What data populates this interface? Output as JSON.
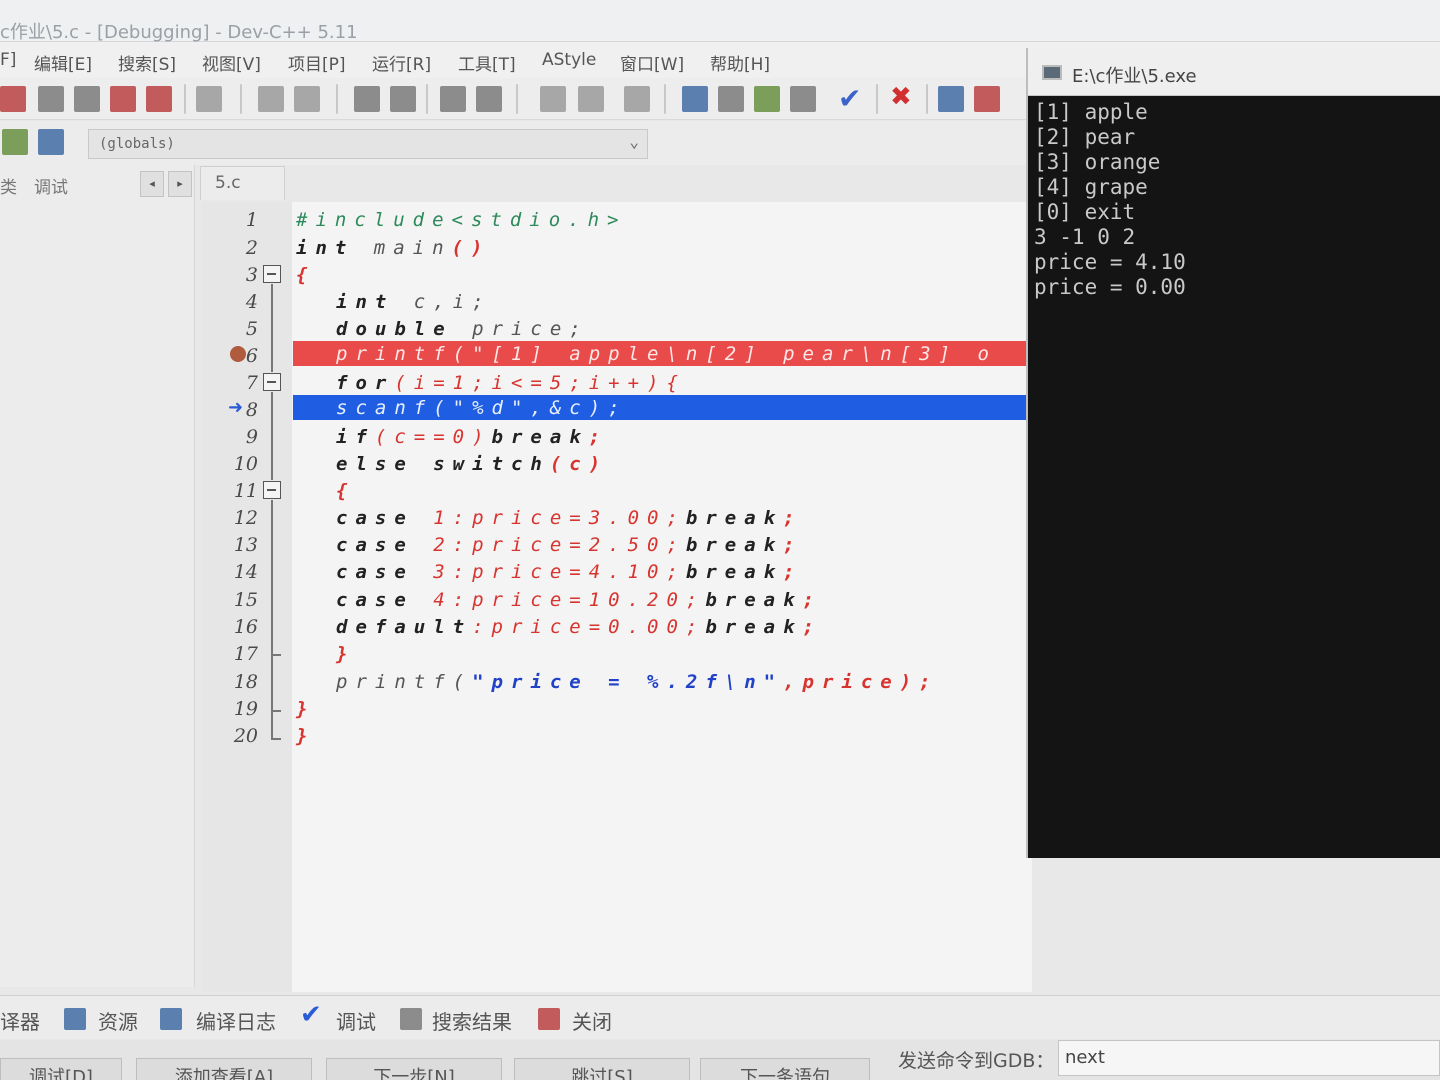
{
  "window": {
    "title": "c作业\\5.c - [Debugging] - Dev-C++ 5.11"
  },
  "menu": [
    "F]",
    "编辑[E]",
    "搜索[S]",
    "视图[V]",
    "项目[P]",
    "运行[R]",
    "工具[T]",
    "AStyle",
    "窗口[W]",
    "帮助[H]"
  ],
  "scope": {
    "value": "(globals)"
  },
  "left_panel": {
    "tab1": "类",
    "tab2": "调试",
    "prev": "◂",
    "next": "▸"
  },
  "file_tab": "5.c",
  "gutter": {
    "lines": [
      "1",
      "2",
      "3",
      "4",
      "5",
      "6",
      "7",
      "8",
      "9",
      "10",
      "11",
      "12",
      "13",
      "14",
      "15",
      "16",
      "17",
      "18",
      "19",
      "20"
    ]
  },
  "code": {
    "l1": "#include<stdio.h>",
    "l2_kw": "int",
    "l2_rest": " main",
    "l2_paren": "()",
    "l3": "{",
    "l4_kw": "int",
    "l4_rest": " c,i;",
    "l5_kw": "double",
    "l5_rest": " price;",
    "l6": "printf(\"[1] apple\\n[2] pear\\n[3] o",
    "l7_kw": "for",
    "l7_rest": "(i=1;i<=5;i++){",
    "l8": "scanf(\"%d\",&c);",
    "l9_kw": "if",
    "l9_rest": "(c==0)",
    "l9_kw2": "break",
    "l9_end": ";",
    "l10_kw": "else",
    "l10_kw2": " switch",
    "l10_rest": "(c)",
    "l11": "{",
    "l12_kw": "case",
    "l12_rest": " 1:price=3.00;",
    "l12_kw2": "break",
    "l12_end": ";",
    "l13_kw": "case",
    "l13_rest": " 2:price=2.50;",
    "l13_kw2": "break",
    "l13_end": ";",
    "l14_kw": "case",
    "l14_rest": " 3:price=4.10;",
    "l14_kw2": "break",
    "l14_end": ";",
    "l15_kw": "case",
    "l15_rest": " 4:price=10.20;",
    "l15_kw2": "break",
    "l15_end": ";",
    "l16_kw": "default",
    "l16_rest": ":price=0.00;",
    "l16_kw2": "break",
    "l16_end": ";",
    "l17": "}",
    "l18_fn": "printf(",
    "l18_str": "\"price = %.2f\\n\"",
    "l18_rest": ",price);",
    "l19": "}",
    "l20": "}"
  },
  "console": {
    "title": "E:\\c作业\\5.exe",
    "output": "[1] apple\n[2] pear\n[3] orange\n[4] grape\n[0] exit\n3 -1 0 2\nprice = 4.10\nprice = 0.00"
  },
  "bottom_tabs": [
    "译器",
    "资源",
    "编译日志",
    "调试",
    "搜索结果",
    "关闭"
  ],
  "bottom_buttons": [
    "调试[D]",
    "添加查看[A]",
    "下一步[N]",
    "跳过[S]",
    "下一条语句"
  ],
  "gdb": {
    "label": "发送命令到GDB：",
    "value": "next"
  },
  "colors": {
    "breakpoint_line": "#e94b4b",
    "exec_line": "#1f5ee3",
    "console_bg": "#141414"
  }
}
